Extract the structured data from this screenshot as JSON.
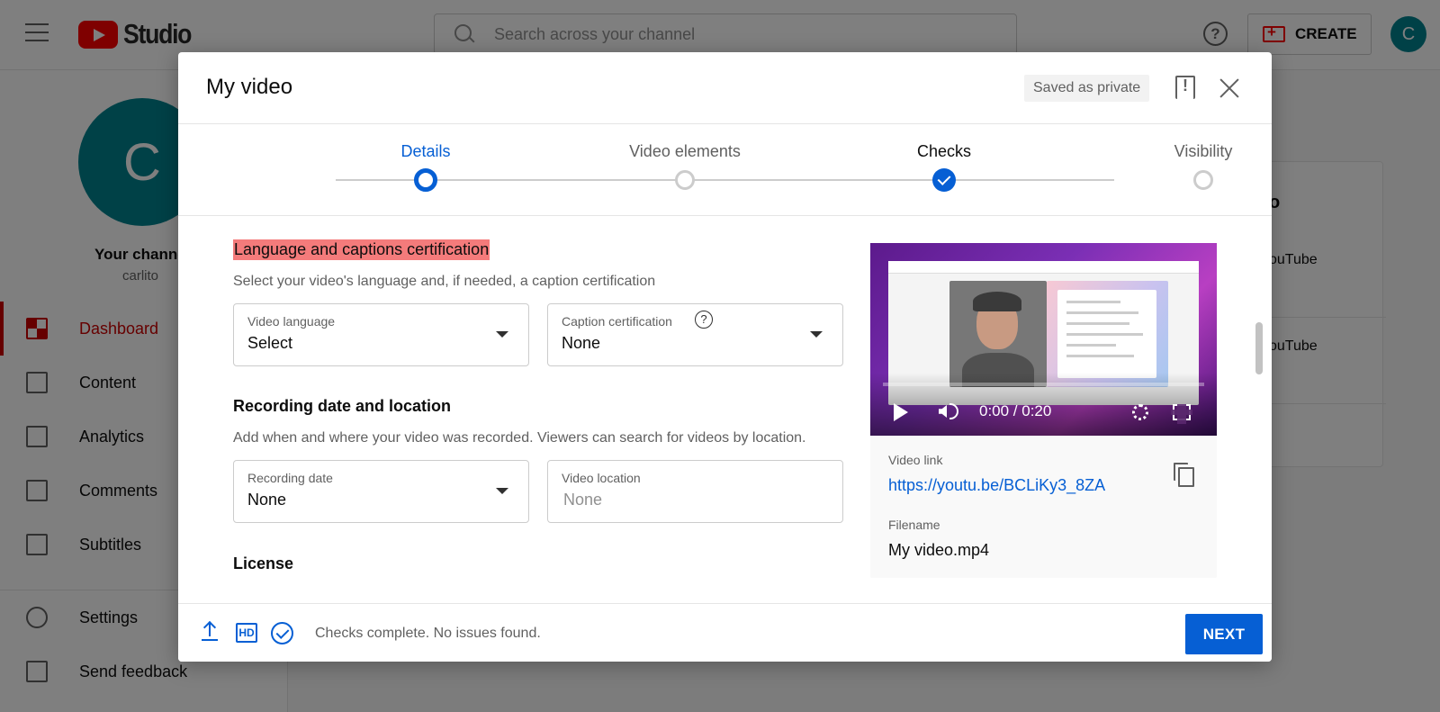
{
  "app": {
    "logo_text": "Studio",
    "search_placeholder": "Search across your channel",
    "help_label": "?",
    "create_label": "CREATE",
    "avatar_initial": "C"
  },
  "sidebar": {
    "avatar_initial": "C",
    "channel_label": "Your channe",
    "channel_handle": "carlito",
    "items": [
      {
        "label": "Dashboard",
        "icon": "dashboard-icon",
        "active": true
      },
      {
        "label": "Content",
        "icon": "content-icon"
      },
      {
        "label": "Analytics",
        "icon": "analytics-icon"
      },
      {
        "label": "Comments",
        "icon": "comments-icon"
      },
      {
        "label": "Subtitles",
        "icon": "subtitles-icon"
      },
      {
        "label": "Settings",
        "icon": "gear-icon"
      },
      {
        "label": "Send feedback",
        "icon": "feedback-icon"
      }
    ]
  },
  "background_card": {
    "line1": "ouTube",
    "line2": "ouTube",
    "heading": "o"
  },
  "dialog": {
    "title": "My video",
    "saved_chip": "Saved as private",
    "steps": [
      {
        "label": "Details",
        "state": "active"
      },
      {
        "label": "Video elements",
        "state": "pending"
      },
      {
        "label": "Checks",
        "state": "done"
      },
      {
        "label": "Visibility",
        "state": "pending"
      }
    ],
    "language_section": {
      "title": "Language and captions certification",
      "description": "Select your video's language and, if needed, a caption certification",
      "video_language": {
        "label": "Video language",
        "value": "Select"
      },
      "caption_certification": {
        "label": "Caption certification",
        "value": "None"
      }
    },
    "recording_section": {
      "title": "Recording date and location",
      "description": "Add when and where your video was recorded. Viewers can search for videos by location.",
      "recording_date": {
        "label": "Recording date",
        "value": "None"
      },
      "video_location": {
        "label": "Video location",
        "placeholder": "None"
      }
    },
    "license_section": {
      "title": "License"
    },
    "preview": {
      "time": "0:00 / 0:20",
      "video_link_label": "Video link",
      "video_link": "https://youtu.be/BCLiKy3_8ZA",
      "filename_label": "Filename",
      "filename": "My video.mp4"
    },
    "footer": {
      "hd_label": "HD",
      "status": "Checks complete. No issues found.",
      "next_label": "NEXT"
    }
  },
  "colors": {
    "accent": "#065fd4",
    "brand_red": "#ff0000",
    "highlight": "#f47b7b",
    "avatar": "#00838f"
  }
}
